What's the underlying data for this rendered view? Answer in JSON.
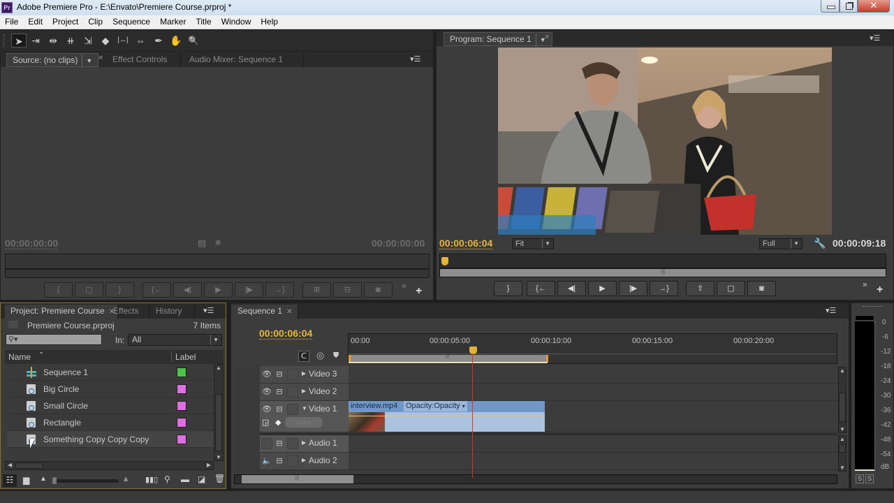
{
  "window": {
    "app_icon": "Pr",
    "title": "Adobe Premiere Pro - E:\\Envato\\Premiere Course.prproj *",
    "minimize": "minimize-icon",
    "maximize": "restore-icon",
    "close": "✕"
  },
  "menu": [
    "File",
    "Edit",
    "Project",
    "Clip",
    "Sequence",
    "Marker",
    "Title",
    "Window",
    "Help"
  ],
  "tools": [
    {
      "name": "selection-tool",
      "glyph": "➤"
    },
    {
      "name": "track-select-tool",
      "glyph": "⇥"
    },
    {
      "name": "ripple-edit-tool",
      "glyph": "⇹"
    },
    {
      "name": "rolling-edit-tool",
      "glyph": "⧺"
    },
    {
      "name": "rate-stretch-tool",
      "glyph": "⇲"
    },
    {
      "name": "razor-tool",
      "glyph": "◆"
    },
    {
      "name": "slip-tool",
      "glyph": "|↔|"
    },
    {
      "name": "slide-tool",
      "glyph": "⇔"
    },
    {
      "name": "pen-tool",
      "glyph": "✒"
    },
    {
      "name": "hand-tool",
      "glyph": "✋"
    },
    {
      "name": "zoom-tool",
      "glyph": "🔍"
    }
  ],
  "source_panel": {
    "tabs": [
      {
        "label": "Source: (no clips)",
        "active": true
      },
      {
        "label": "Effect Controls",
        "active": false
      },
      {
        "label": "Audio Mixer: Sequence 1",
        "active": false
      }
    ],
    "timecode_left": "00:00:00:00",
    "timecode_right": "00:00:00:00",
    "buttons": [
      "mark-in",
      "mark-clip",
      "mark-out",
      "go-to-in",
      "step-back",
      "play",
      "step-forward",
      "go-to-out",
      "insert",
      "overlay",
      "export-frame"
    ]
  },
  "program_panel": {
    "tab": "Program: Sequence 1",
    "timecode_current": "00:00:06:04",
    "zoom_select": "Fit",
    "quality_select": "Full",
    "timecode_duration": "00:00:09:18",
    "buttons": [
      "mark-out",
      "go-to-in",
      "step-back",
      "play",
      "step-forward",
      "go-to-out",
      "lift",
      "extract",
      "export-frame"
    ],
    "playhead_fraction": 0.0
  },
  "project_panel": {
    "tabs": [
      {
        "label": "Project: Premiere Course",
        "active": true
      },
      {
        "label": "Effects",
        "active": false
      },
      {
        "label": "History",
        "active": false
      }
    ],
    "project_file": "Premiere Course.prproj",
    "item_count": "7 Items",
    "search_placeholder": "",
    "in_label": "In:",
    "in_value": "All",
    "col_name": "Name",
    "col_label": "Label",
    "items": [
      {
        "name": "Sequence 1",
        "type": "sequence",
        "label_color": "#4cc44c"
      },
      {
        "name": "Big Circle",
        "type": "graphic",
        "label_color": "#dd6fe0"
      },
      {
        "name": "Small Circle",
        "type": "graphic",
        "label_color": "#dd6fe0"
      },
      {
        "name": "Rectangle",
        "type": "graphic",
        "label_color": "#dd6fe0"
      },
      {
        "name": "Something Copy Copy Copy",
        "type": "graphic",
        "label_color": "#dd6fe0"
      }
    ]
  },
  "timeline": {
    "tab": "Sequence 1",
    "timecode": "00:00:06:04",
    "ruler": [
      "00:00",
      "00:00:05:00",
      "00:00:10:00",
      "00:00:15:00",
      "00:00:20:00"
    ],
    "tracks": [
      {
        "name": "Video 3",
        "kind": "video",
        "expanded": false
      },
      {
        "name": "Video 2",
        "kind": "video",
        "expanded": false
      },
      {
        "name": "Video 1",
        "kind": "video",
        "expanded": true
      },
      {
        "name": "Audio 1",
        "kind": "audio",
        "expanded": false
      },
      {
        "name": "Audio 2",
        "kind": "audio",
        "expanded": false
      }
    ],
    "clip": {
      "name": "interview.mp4",
      "effect": "Opacity:Opacity"
    }
  },
  "audio_meter": {
    "scale": [
      "0",
      "-6",
      "-12",
      "-18",
      "-24",
      "-30",
      "-36",
      "-42",
      "-48",
      "-54",
      "dB"
    ],
    "solo_left": "S",
    "solo_right": "S"
  },
  "colors": {
    "accent_timecode": "#e8b53a",
    "playhead": "#d03a2a",
    "clip": "#a9c3e0"
  }
}
